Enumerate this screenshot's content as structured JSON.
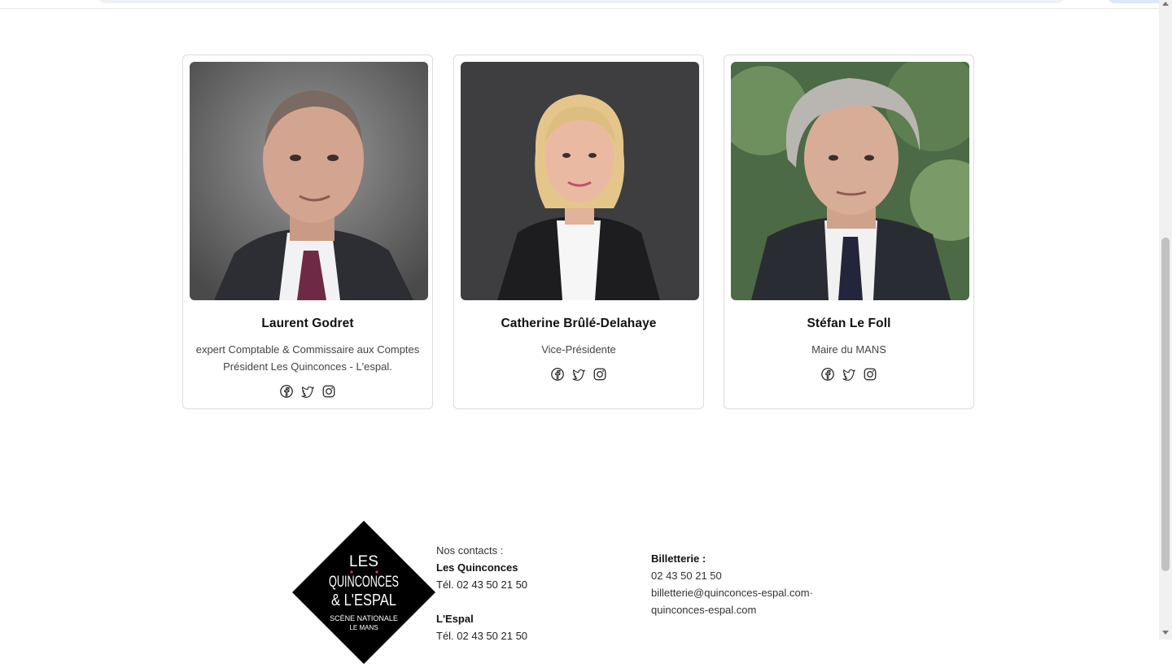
{
  "members": [
    {
      "name": "Laurent Godret",
      "role_lines": [
        "expert Comptable & Commissaire aux Comptes",
        "Président Les Quinconces - L'espal."
      ]
    },
    {
      "name": "Catherine Brûlé-Delahaye",
      "role_lines": [
        "Vice-Présidente"
      ]
    },
    {
      "name": "Stéfan Le Foll",
      "role_lines": [
        "Maire du MANS"
      ]
    }
  ],
  "social_icons": [
    "facebook-icon",
    "twitter-icon",
    "instagram-icon"
  ],
  "footer": {
    "logo": {
      "line1": "LES",
      "line2": "QUINCONCES",
      "line3": "& L'ESPAL",
      "line4": "SCÈNE NATIONALE",
      "line5": "LE MANS"
    },
    "contacts": {
      "label": "Nos contacts :",
      "venue1": "Les Quinconces",
      "phone1": "Tél. 02 43 50 21 50",
      "venue2": "L'Espal",
      "phone2": "Tél. 02 43 50 21 50"
    },
    "billetterie": {
      "label": "Billetterie :",
      "phone": "02 43 50 21 50",
      "email": "billetterie@quinconces-espal.com",
      "site": "quinconces-espal.com"
    }
  },
  "colors": {
    "border": "#dcdcdc",
    "logo_bg": "#000000",
    "logo_accent": "#d6336c"
  }
}
